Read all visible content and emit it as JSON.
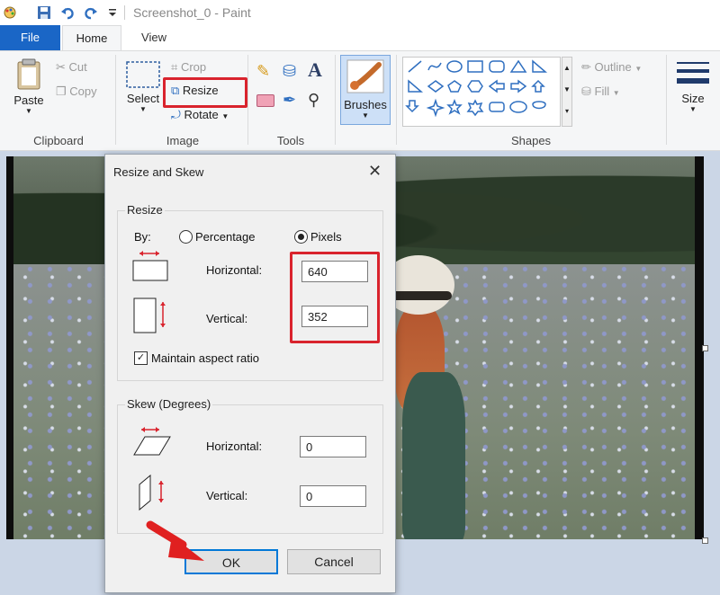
{
  "window": {
    "title": "Screenshot_0 - Paint"
  },
  "quick_access": {
    "icons": [
      "paint-app-icon",
      "save-icon",
      "undo-icon",
      "redo-icon",
      "customize-icon"
    ]
  },
  "tabs": {
    "file": "File",
    "home": "Home",
    "view": "View"
  },
  "ribbon": {
    "clipboard": {
      "label": "Clipboard",
      "paste": "Paste",
      "cut": "Cut",
      "copy": "Copy"
    },
    "image": {
      "label": "Image",
      "select": "Select",
      "crop": "Crop",
      "resize": "Resize",
      "rotate": "Rotate"
    },
    "tools": {
      "label": "Tools"
    },
    "brushes": {
      "label": "Brushes"
    },
    "shapes": {
      "label": "Shapes",
      "outline": "Outline",
      "fill": "Fill"
    },
    "size": {
      "label": "Size"
    }
  },
  "dialog": {
    "title": "Resize and Skew",
    "resize": {
      "title": "Resize",
      "by": "By:",
      "percentage": "Percentage",
      "pixels": "Pixels",
      "selected_unit": "Pixels",
      "horizontal_label": "Horizontal:",
      "horizontal_value": "640",
      "vertical_label": "Vertical:",
      "vertical_value": "352",
      "maintain_aspect": "Maintain aspect ratio",
      "maintain_aspect_checked": true
    },
    "skew": {
      "title": "Skew (Degrees)",
      "horizontal_label": "Horizontal:",
      "horizontal_value": "0",
      "vertical_label": "Vertical:",
      "vertical_value": "0"
    },
    "ok": "OK",
    "cancel": "Cancel"
  },
  "colors": {
    "highlight": "#d9232d",
    "file_tab": "#1a66c6"
  }
}
